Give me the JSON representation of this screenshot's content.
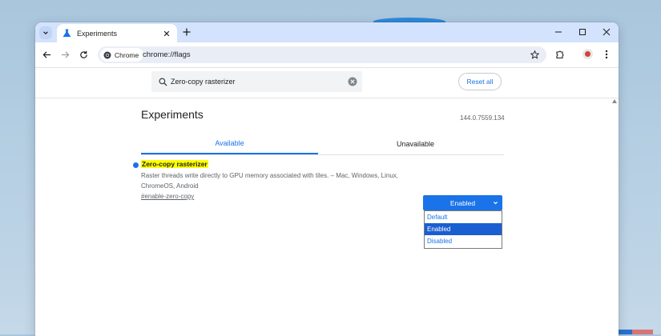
{
  "tab": {
    "title": "Experiments"
  },
  "toolbar": {
    "chip_label": "Chrome",
    "url": "chrome://flags"
  },
  "flags_search": {
    "value": "Zero-copy rasterizer",
    "reset_label": "Reset all"
  },
  "page": {
    "title": "Experiments",
    "version": "144.0.7559.134",
    "tabs": [
      {
        "label": "Available"
      },
      {
        "label": "Unavailable"
      }
    ]
  },
  "flag": {
    "name": "Zero-copy rasterizer",
    "description": "Raster threads write directly to GPU memory associated with tiles. – Mac, Windows, Linux, ChromeOS, Android",
    "link": "#enable-zero-copy",
    "selected": "Enabled",
    "options": [
      "Default",
      "Enabled",
      "Disabled"
    ]
  },
  "colors": {
    "accent": "#1a73e8",
    "highlight": "#ffff00",
    "tabstrip": "#d3e3fd"
  }
}
